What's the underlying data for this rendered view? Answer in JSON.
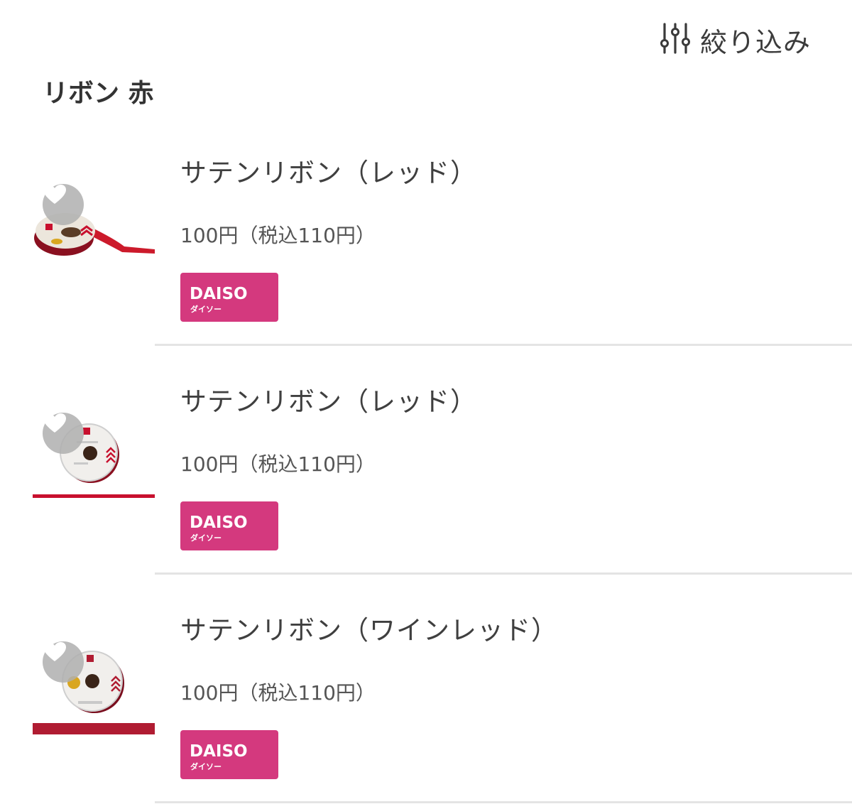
{
  "header": {
    "filter_label": "絞り込み",
    "filter_icon": "sliders-icon",
    "title": "リボン 赤"
  },
  "colors": {
    "brand_badge": "#d4397e",
    "ribbon_red": "#c8102e",
    "wine_red": "#b01c32",
    "favorite_bg": "#afafaf"
  },
  "products": [
    {
      "name": "サテンリボン（レッド）",
      "price": "100円（税込110円）",
      "brand": "DAISO",
      "brand_kana": "ダイソー",
      "favorite_icon": "heart-icon"
    },
    {
      "name": "サテンリボン（レッド）",
      "price": "100円（税込110円）",
      "brand": "DAISO",
      "brand_kana": "ダイソー",
      "favorite_icon": "heart-icon"
    },
    {
      "name": "サテンリボン（ワインレッド）",
      "price": "100円（税込110円）",
      "brand": "DAISO",
      "brand_kana": "ダイソー",
      "favorite_icon": "heart-icon"
    }
  ]
}
